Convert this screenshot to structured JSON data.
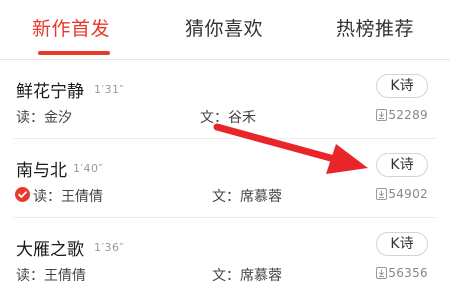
{
  "tabs": [
    {
      "label": "新作首发",
      "active": true
    },
    {
      "label": "猜你喜欢",
      "active": false
    },
    {
      "label": "热榜推荐",
      "active": false
    }
  ],
  "rows": [
    {
      "title": "鲜花宁静",
      "duration": "1′31″",
      "reader": "读：金汐",
      "writer": "文：谷禾",
      "button": "K诗",
      "downloads": "52289",
      "verified": false
    },
    {
      "title": "南与北",
      "duration": "1′40″",
      "reader": "读：王倩倩",
      "writer": "文：席慕蓉",
      "button": "K诗",
      "downloads": "54902",
      "verified": true
    },
    {
      "title": "大雁之歌",
      "duration": "1′36″",
      "reader": "读：王倩倩",
      "writer": "文：席慕蓉",
      "button": "K诗",
      "downloads": "56356",
      "verified": false
    }
  ],
  "colors": {
    "accent": "#e83a2a",
    "arrow": "#e8262a"
  },
  "icons": {
    "download": "download-icon",
    "verified": "verified-check-icon"
  }
}
